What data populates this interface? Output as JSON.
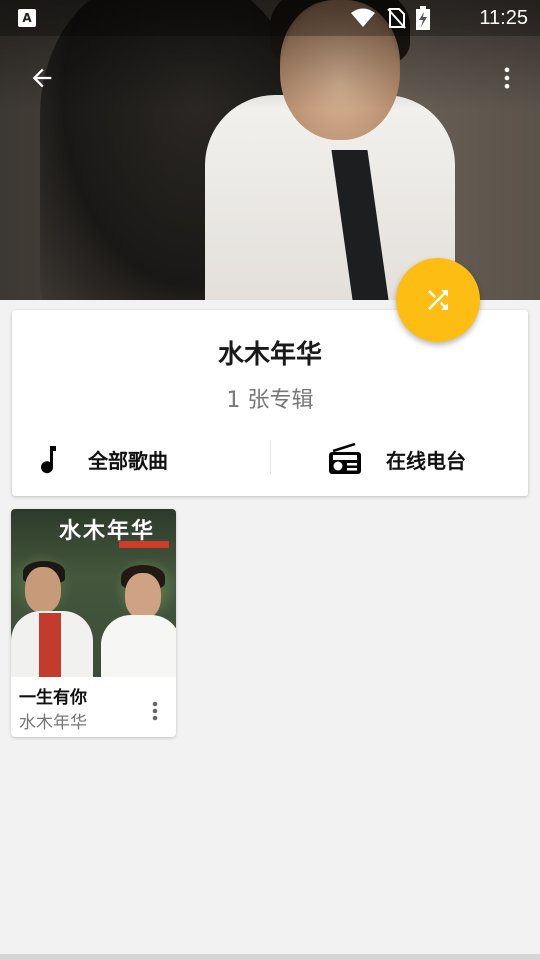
{
  "status_bar": {
    "app_badge": "A",
    "time": "11:25",
    "icons": [
      "app-notification-icon",
      "wifi-icon",
      "no-sim-icon",
      "battery-charging-icon"
    ]
  },
  "toolbar": {
    "back_icon": "arrow-back-icon",
    "more_icon": "more-vert-icon"
  },
  "fab": {
    "icon": "shuffle-icon",
    "accent_color": "#fdbd12"
  },
  "artist": {
    "name": "水木年华",
    "album_count": "1 张专辑"
  },
  "actions": {
    "all_songs": {
      "label": "全部歌曲",
      "icon": "music-note-icon"
    },
    "online_radio": {
      "label": "在线电台",
      "icon": "radio-icon"
    }
  },
  "albums": [
    {
      "title": "一生有你",
      "artist": "水木年华",
      "cover_text": "水木年华"
    }
  ],
  "colors": {
    "background": "#f2f2f2",
    "card": "#ffffff",
    "primary_text": "#111111",
    "secondary_text": "#777777"
  }
}
